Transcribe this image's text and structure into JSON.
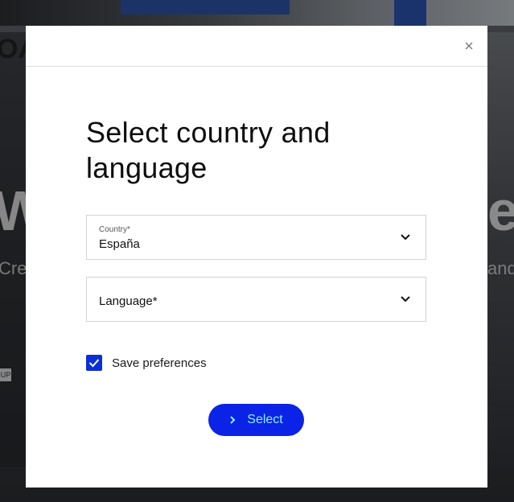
{
  "background": {
    "brand_fragment": "OAI",
    "heading_left": "W",
    "heading_right": "e",
    "sub_left": "Cre",
    "sub_right": "and",
    "badge": "UP"
  },
  "modal": {
    "close_label": "×",
    "title": "Select country and language",
    "country": {
      "label": "Country*",
      "value": "España"
    },
    "language": {
      "placeholder": "Language*"
    },
    "save_preferences": {
      "label": "Save preferences",
      "checked": true
    },
    "submit_label": "Select"
  },
  "colors": {
    "accent": "#0a23e6",
    "button_text": "#8cf0ff",
    "checkbox": "#0a2fd6"
  }
}
